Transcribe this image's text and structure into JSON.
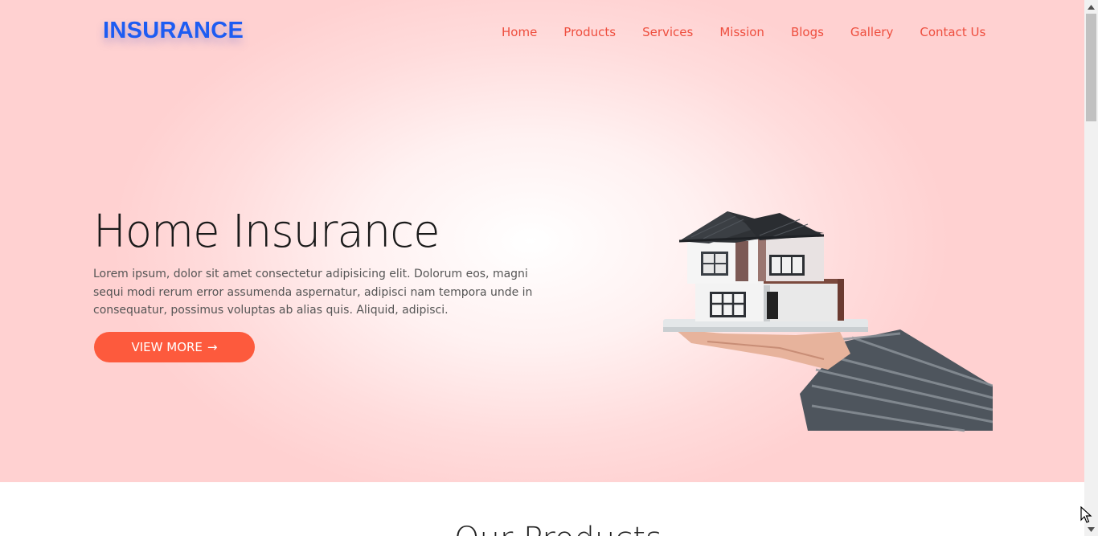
{
  "brand": {
    "logo_text": "INSURANCE"
  },
  "nav": {
    "items": [
      "Home",
      "Products",
      "Services",
      "Mission",
      "Blogs",
      "Gallery",
      "Contact Us"
    ]
  },
  "hero": {
    "title": "Home Insurance",
    "text": "Lorem ipsum, dolor sit amet consectetur adipisicing elit. Dolorum eos, magni sequi modi rerum error assumenda aspernatur, adipisci nam tempora unde in consequatur, possimus voluptas ab alias quis. Aliquid, adipisci.",
    "button_label": "VIEW MORE",
    "button_arrow": "→",
    "image": "hand-holding-house-model"
  },
  "products": {
    "title": "Our Products"
  },
  "colors": {
    "brand_blue": "#1d5cf2",
    "accent_red": "#ee4e3e",
    "button": "#fd5a3d",
    "hero_bg": "#ffd1d1"
  }
}
